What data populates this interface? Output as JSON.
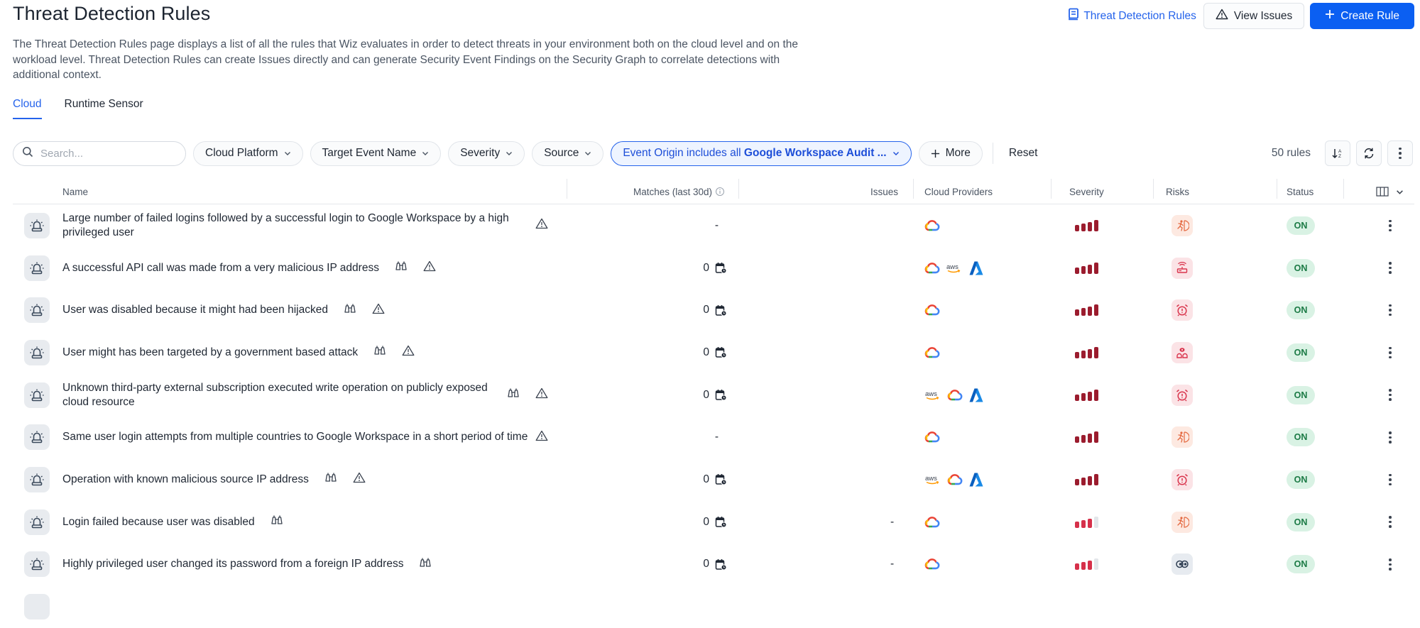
{
  "header": {
    "title": "Threat Detection Rules",
    "description": "The Threat Detection Rules page displays a list of all the rules that Wiz evaluates in order to detect threats in your environment both on the cloud level and on the workload level. Threat Detection Rules can create Issues directly and can generate Security Event Findings on the Security Graph to correlate detections with additional context.",
    "doc_link": "Threat Detection Rules",
    "view_issues": "View Issues",
    "create_rule": "Create Rule"
  },
  "tabs": [
    {
      "label": "Cloud",
      "active": true
    },
    {
      "label": "Runtime Sensor",
      "active": false
    }
  ],
  "filters": {
    "search_placeholder": "Search...",
    "search_value": "",
    "chips": [
      "Cloud Platform",
      "Target Event Name",
      "Severity",
      "Source"
    ],
    "active_chip_prefix": "Event Origin includes all",
    "active_chip_value": "Google Workspace Audit ...",
    "more": "More",
    "reset": "Reset",
    "count": "50 rules"
  },
  "columns": {
    "name": "Name",
    "matches": "Matches (last 30d)",
    "issues": "Issues",
    "providers": "Cloud Providers",
    "severity": "Severity",
    "risks": "Risks",
    "status": "Status"
  },
  "colors": {
    "accent": "#2563eb",
    "primary_button": "#0b5ff2",
    "severity_critical": "#9b1c2e",
    "severity_high": "#d6304a",
    "severity_empty": "#e3e6ea",
    "status_bg": "#d9f2e4",
    "status_text": "#1b7a45"
  },
  "rows": [
    {
      "name": "Large number of failed logins followed by a successful login to Google Workspace by a high privileged user",
      "binoculars": false,
      "warning": true,
      "matches": "-",
      "has_calendar": false,
      "issues": "",
      "providers": [
        "gcp"
      ],
      "severity": "critical",
      "severity_level": 4,
      "risk": "intrusion",
      "status": "ON"
    },
    {
      "name": "A successful API call was made from a very malicious IP address",
      "binoculars": true,
      "warning": true,
      "matches": "0",
      "has_calendar": true,
      "issues": "",
      "providers": [
        "gcp",
        "aws",
        "azure"
      ],
      "severity": "critical",
      "severity_level": 4,
      "risk": "network-exposure",
      "status": "ON"
    },
    {
      "name": "User was disabled because it might had been hijacked",
      "binoculars": true,
      "warning": true,
      "matches": "0",
      "has_calendar": true,
      "issues": "",
      "providers": [
        "gcp"
      ],
      "severity": "critical",
      "severity_level": 4,
      "risk": "alarm",
      "status": "ON"
    },
    {
      "name": "User might has been targeted by a government based attack",
      "binoculars": true,
      "warning": true,
      "matches": "0",
      "has_calendar": true,
      "issues": "",
      "providers": [
        "gcp"
      ],
      "severity": "critical",
      "severity_level": 4,
      "risk": "threat-actor",
      "status": "ON"
    },
    {
      "name": "Unknown third-party external subscription executed write operation on publicly exposed cloud resource",
      "binoculars": true,
      "warning": true,
      "matches": "0",
      "has_calendar": true,
      "issues": "",
      "providers": [
        "aws",
        "gcp",
        "azure"
      ],
      "severity": "critical",
      "severity_level": 4,
      "risk": "alarm",
      "status": "ON"
    },
    {
      "name": "Same user login attempts from multiple countries to Google Workspace in a short period of time",
      "binoculars": false,
      "warning": true,
      "matches": "-",
      "has_calendar": false,
      "issues": "",
      "providers": [
        "gcp"
      ],
      "severity": "critical",
      "severity_level": 4,
      "risk": "intrusion",
      "status": "ON"
    },
    {
      "name": "Operation with known malicious source IP address",
      "binoculars": true,
      "warning": true,
      "matches": "0",
      "has_calendar": true,
      "issues": "",
      "providers": [
        "aws",
        "gcp",
        "azure"
      ],
      "severity": "critical",
      "severity_level": 4,
      "risk": "alarm",
      "status": "ON"
    },
    {
      "name": "Login failed because user was disabled",
      "binoculars": true,
      "warning": false,
      "matches": "0",
      "has_calendar": true,
      "issues": "-",
      "providers": [
        "gcp"
      ],
      "severity": "high",
      "severity_level": 3,
      "risk": "intrusion",
      "status": "ON"
    },
    {
      "name": "Highly privileged user changed its password from a foreign IP address",
      "binoculars": true,
      "warning": false,
      "matches": "0",
      "has_calendar": true,
      "issues": "-",
      "providers": [
        "gcp"
      ],
      "severity": "high",
      "severity_level": 3,
      "risk": "identity",
      "status": "ON"
    }
  ]
}
